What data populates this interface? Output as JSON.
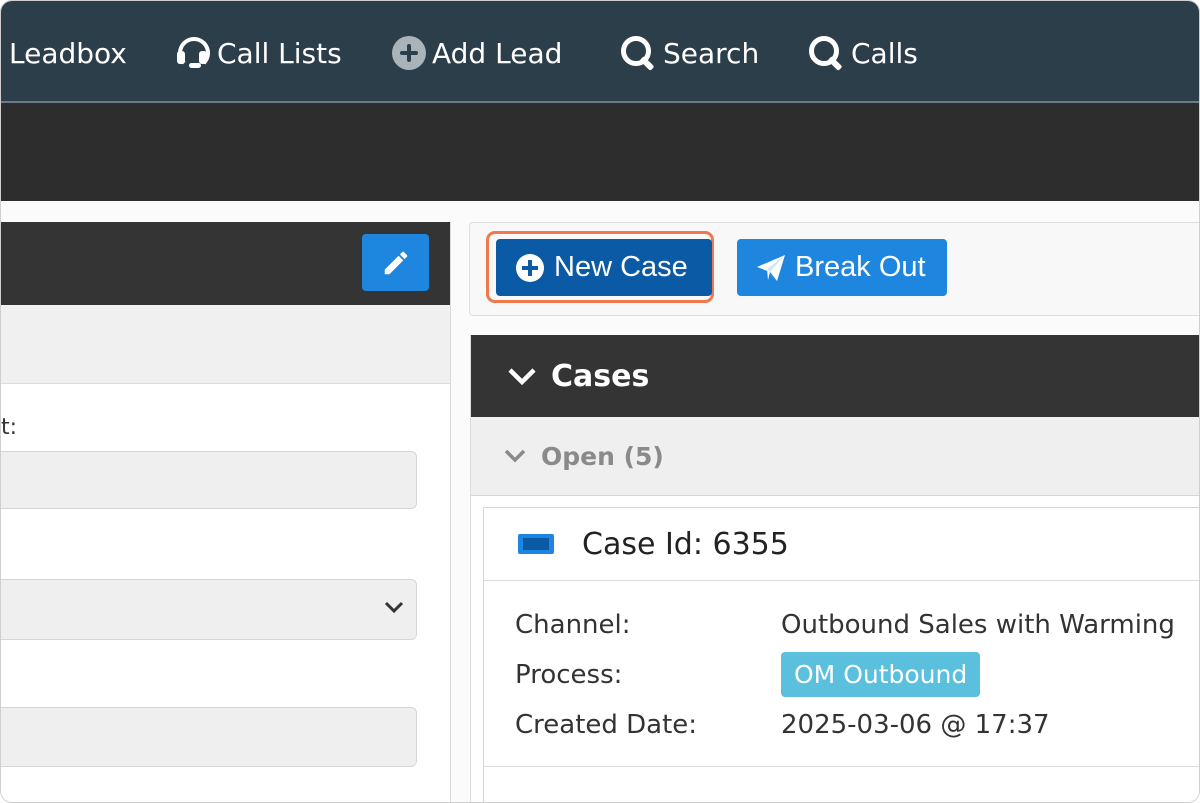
{
  "topnav": {
    "items": [
      {
        "label": "Leadbox",
        "icon": "none"
      },
      {
        "label": "Call Lists",
        "icon": "headset-icon"
      },
      {
        "label": "Add Lead",
        "icon": "plus-circle-icon"
      },
      {
        "label": "Search",
        "icon": "search-icon"
      },
      {
        "label": "Calls",
        "icon": "search-icon"
      }
    ]
  },
  "left_panel": {
    "edit_icon": "pencil-icon",
    "field_label_fragment": "t:"
  },
  "toolbar": {
    "new_case_label": "New Case",
    "break_out_label": "Break Out"
  },
  "cases": {
    "title": "Cases",
    "open_label": "Open (5)",
    "card": {
      "title": "Case Id: 6355",
      "channel_label": "Channel:",
      "channel_value": "Outbound Sales with Warming",
      "process_label": "Process:",
      "process_value": "OM Outbound",
      "created_label": "Created Date:",
      "created_value": "2025-03-06 @ 17:37"
    }
  },
  "colors": {
    "nav_bg": "#2c3e4a",
    "primary": "#1f86e0",
    "primary_dark": "#0b5aa6",
    "badge": "#5bc0de",
    "focus_ring": "#f0784b"
  }
}
